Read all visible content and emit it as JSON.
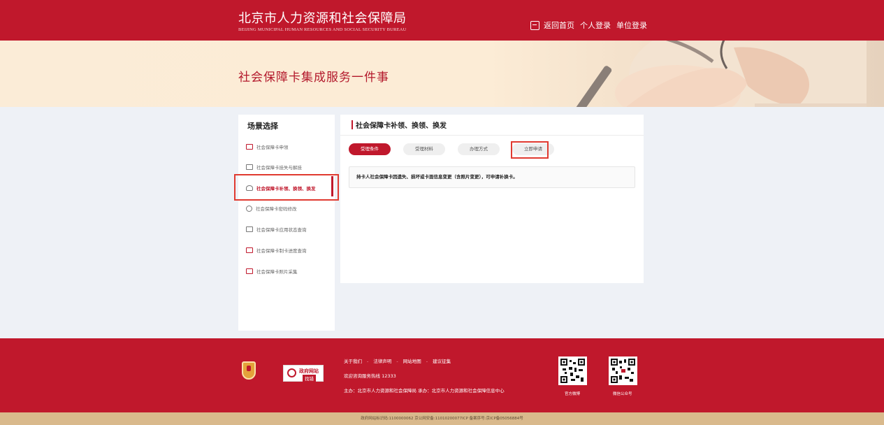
{
  "header": {
    "title_cn": "北京市人力资源和社会保障局",
    "title_en": "BEIJING MUNICIPAL HUMAN RESOURCES AND SOCIAL SECURITY BUREAU",
    "nav": {
      "home": "返回首页",
      "personal_login": "个人登录",
      "unit_login": "单位登录"
    }
  },
  "banner": {
    "title": "社会保障卡集成服务一件事"
  },
  "sidebar": {
    "title": "场景选择",
    "items": [
      {
        "label": "社会保障卡申领",
        "icon": "id-card-icon"
      },
      {
        "label": "社会保障卡挂失与解挂",
        "icon": "card-lock-icon"
      },
      {
        "label": "社会保障卡补领、换领、换发",
        "icon": "user-card-icon",
        "active": true
      },
      {
        "label": "社会保障卡密码修改",
        "icon": "password-icon"
      },
      {
        "label": "社会保障卡应用状态查询",
        "icon": "status-query-icon"
      },
      {
        "label": "社会保障卡制卡进度查询",
        "icon": "progress-icon"
      },
      {
        "label": "社会保障卡照片采集",
        "icon": "photo-icon"
      }
    ]
  },
  "main": {
    "title": "社会保障卡补领、换领、换发",
    "tabs": [
      {
        "label": "受理条件",
        "active": true
      },
      {
        "label": "受理材料"
      },
      {
        "label": "办理方式"
      },
      {
        "label": "立即申请"
      }
    ],
    "notice": "持卡人社会保障卡因遗失、损坏或卡面信息变更（含照片变更），可申请补换卡。"
  },
  "footer": {
    "links": [
      "关于我们",
      "法律声明",
      "网站地图",
      "建议征集"
    ],
    "link_separator": "-",
    "hotline": "欢迎咨询服务热线 12333",
    "organizer": "主办：北京市人力资源和社会保障局  承办：北京市人力资源和社会保障信息中心",
    "gov_badge_line1": "政府网站",
    "gov_badge_line2": "找错",
    "qr_labels": [
      "官方微博",
      "微信公众号"
    ],
    "bottom": "政府网站标识码:1100000062   京公网安备:11010200077ICP   备案序号:京ICP备05056884号"
  },
  "colors": {
    "brand": "#c0182c",
    "banner_bg": "#fcecd6",
    "footer_bottom": "#d9b98c",
    "highlight": "#e03a30"
  }
}
